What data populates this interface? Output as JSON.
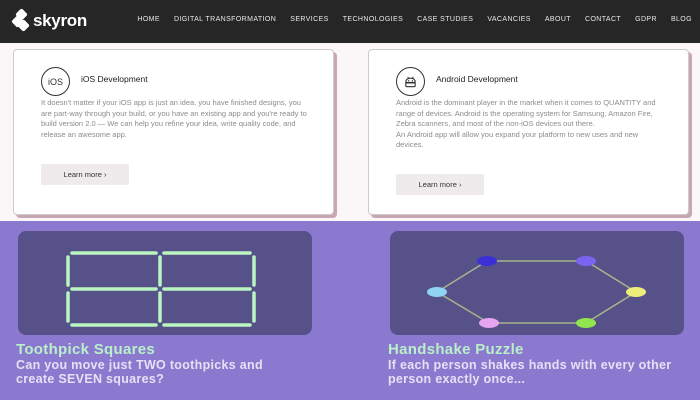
{
  "brand": {
    "name": "skyron"
  },
  "nav": {
    "items": [
      "HOME",
      "DIGITAL TRANSFORMATION",
      "SERVICES",
      "TECHNOLOGIES",
      "CASE STUDIES",
      "VACANCIES",
      "ABOUT",
      "CONTACT",
      "GDPR",
      "BLOG"
    ]
  },
  "cards": [
    {
      "icon_label": "iOS",
      "title": "iOS Development",
      "body": "It doesn't matter if your iOS app is just an idea, you have finished designs, you are part-way through your build, or you have an existing app and you're ready to build version 2.0 — We can help you refine your idea, write quality code, and release an awesome app.",
      "button": "Learn more ›"
    },
    {
      "icon": "android-icon",
      "title": "Android Development",
      "body": "Android is the dominant player in the market when it comes to QUANTITY and range of devices. Android is the operating system for Samsung, Amazon Fire, Zebra scanners, and most of the non-iOS devices out there.",
      "body2": "An Android app will allow you expand your platform to new uses and new devices.",
      "button": "Learn more ›"
    }
  ],
  "puzzles": [
    {
      "title": "Toothpick Squares",
      "desc": "Can you move just TWO toothpicks and create SEVEN squares?"
    },
    {
      "title": "Handshake Puzzle",
      "desc": "If each person shakes hands with every other person exactly once..."
    }
  ],
  "colors": {
    "nav_bg": "#262626",
    "purple_bg": "#8a79cf",
    "tile_bg": "#57518a",
    "puzzle_title": "#b9f0ca",
    "toothpick": "#b8f5c0",
    "node_colors": [
      "#3b2fd6",
      "#7a63f0",
      "#f0ee7a",
      "#8fe64f",
      "#e7a4f0",
      "#8fd4f5"
    ]
  }
}
